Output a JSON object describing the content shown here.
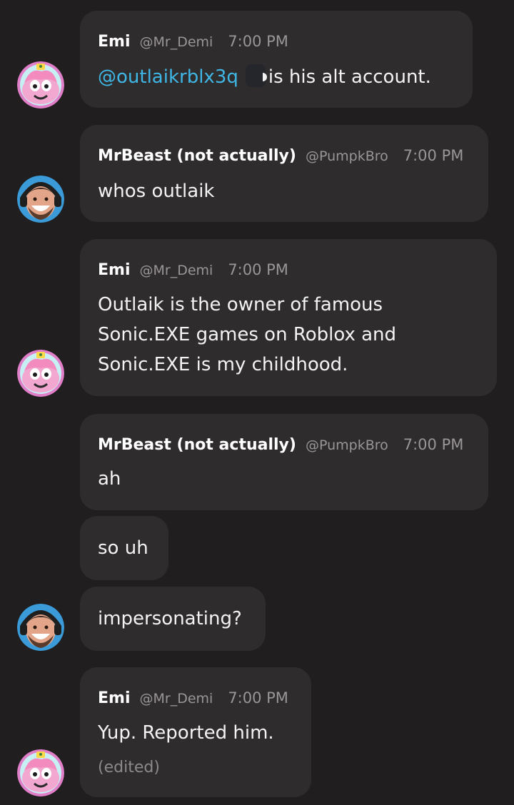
{
  "messages": [
    {
      "author": "Emi",
      "handle": "@Mr_Demi",
      "time": "7:00 PM",
      "mention": "@outlaikrblx3q",
      "text": "is his alt account."
    },
    {
      "author": "MrBeast (not actually)",
      "handle": "@PumpkBro",
      "time": "7:00 PM",
      "text": "whos outlaik"
    },
    {
      "author": "Emi",
      "handle": "@Mr_Demi",
      "time": "7:00 PM",
      "lines": [
        "Outlaik is the owner of famous",
        "Sonic.EXE games on Roblox and",
        "Sonic.EXE is my childhood."
      ]
    },
    {
      "author": "MrBeast (not actually)",
      "handle": "@PumpkBro",
      "time": "7:00 PM",
      "text": "ah"
    },
    {
      "text": "so uh"
    },
    {
      "text": "impersonating?"
    },
    {
      "author": "Emi",
      "handle": "@Mr_Demi",
      "time": "7:00 PM",
      "text": "Yup. Reported him.",
      "edited": "(edited)"
    }
  ],
  "avatars": {
    "emi": "pink-cartoon-character-avatar",
    "mrbeast": "smiling-man-with-headphones-avatar"
  },
  "colors": {
    "background": "#201e1f",
    "bubble": "#2f2c2d",
    "mention": "#3fb7e6",
    "muted": "#9a9698"
  }
}
